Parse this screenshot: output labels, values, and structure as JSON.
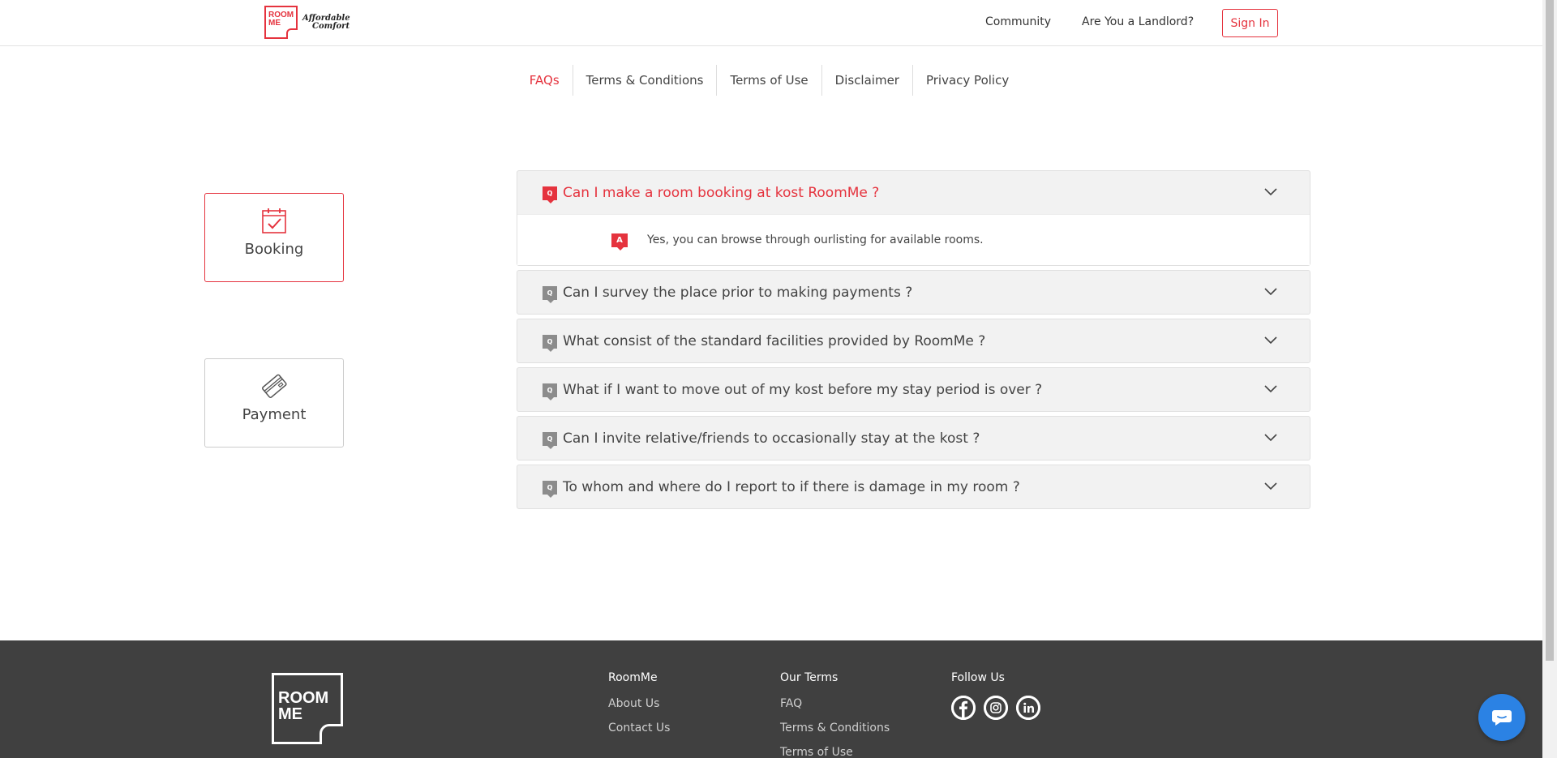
{
  "header": {
    "logo_text_line1": "ROOM",
    "logo_text_line2": "ME",
    "tagline_line1": "Affordable",
    "tagline_line2": "Comfort",
    "nav": [
      "Community",
      "Are You a Landlord?"
    ],
    "signin_label": "Sign In"
  },
  "tabs": [
    {
      "label": "FAQs",
      "active": true
    },
    {
      "label": "Terms & Conditions",
      "active": false
    },
    {
      "label": "Terms of Use",
      "active": false
    },
    {
      "label": "Disclaimer",
      "active": false
    },
    {
      "label": "Privacy Policy",
      "active": false
    }
  ],
  "categories": [
    {
      "label": "Booking",
      "icon": "calendar-check-icon",
      "active": true
    },
    {
      "label": "Payment",
      "icon": "credit-card-icon",
      "active": false
    }
  ],
  "faq": {
    "q_badge": "Q",
    "a_badge": "A",
    "items": [
      {
        "question": "Can I make a room booking at kost RoomMe ?",
        "answer": "Yes, you can browse through ourlisting for available rooms.",
        "open": true
      },
      {
        "question": "Can I survey the place prior to making payments ?",
        "open": false
      },
      {
        "question": "What consist of the standard facilities provided by RoomMe ?",
        "open": false
      },
      {
        "question": "What if I want to move out of my kost before my stay period is over ?",
        "open": false
      },
      {
        "question": "Can I invite relative/friends to occasionally stay at the kost ?",
        "open": false
      },
      {
        "question": "To whom and where do I report to if there is damage in my room ?",
        "open": false
      }
    ]
  },
  "footer": {
    "logo_line1": "ROOM",
    "logo_line2": "ME",
    "col1": {
      "heading": "RoomMe",
      "links": [
        "About Us",
        "Contact Us"
      ]
    },
    "col2": {
      "heading": "Our Terms",
      "links": [
        "FAQ",
        "Terms & Conditions",
        "Terms of Use"
      ]
    },
    "col3": {
      "heading": "Follow Us",
      "icons": [
        "facebook-icon",
        "instagram-icon",
        "linkedin-icon"
      ]
    }
  },
  "colors": {
    "accent": "#e5333e",
    "footer_bg": "#404040",
    "chat": "#2b82e4"
  }
}
